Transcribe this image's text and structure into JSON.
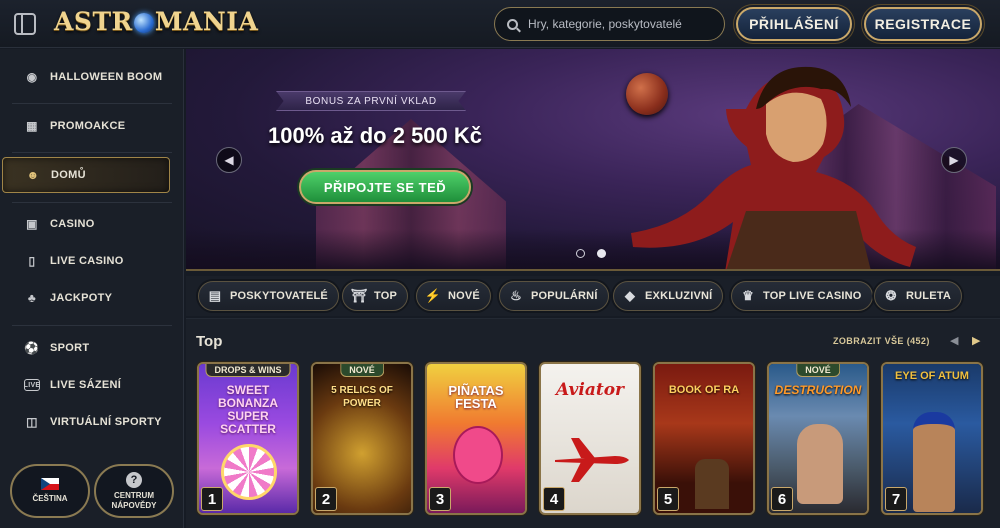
{
  "header": {
    "logo_text": "ASTROMANIA",
    "search_placeholder": "Hry, kategorie, poskytovatelé",
    "login_label": "PŘIHLÁŠENÍ",
    "register_label": "REGISTRACE"
  },
  "sidebar": {
    "items": [
      {
        "label": "HALLOWEEN BOOM",
        "icon": "pumpkin-icon"
      },
      {
        "label": "PROMOAKCE",
        "icon": "gift-icon"
      },
      {
        "label": "DOMŮ",
        "icon": "home-icon",
        "active": true
      },
      {
        "label": "CASINO",
        "icon": "slot-machine-icon"
      },
      {
        "label": "LIVE CASINO",
        "icon": "phone-icon"
      },
      {
        "label": "JACKPOTY",
        "icon": "clover-icon"
      },
      {
        "label": "SPORT",
        "icon": "soccer-ball-icon"
      },
      {
        "label": "LIVE SÁZENÍ",
        "icon": "live-icon"
      },
      {
        "label": "VIRTUÁLNÍ SPORTY",
        "icon": "monitor-icon"
      }
    ],
    "language_label": "ČEŠTINA",
    "help_label_line1": "CENTRUM",
    "help_label_line2": "NÁPOVĚDY"
  },
  "banner": {
    "ribbon_text": "BONUS ZA PRVNÍ VKLAD",
    "headline": "100% až do 2 500 Kč",
    "cta_label": "PŘIPOJTE SE TEĎ",
    "slides": 2,
    "active_slide": 2
  },
  "chips": [
    {
      "label": "POSKYTOVATELÉ",
      "icon": "providers-icon"
    },
    {
      "label": "TOP",
      "icon": "trophy-icon"
    },
    {
      "label": "NOVÉ",
      "icon": "lightning-icon"
    },
    {
      "label": "POPULÁRNÍ",
      "icon": "flame-icon"
    },
    {
      "label": "EXKLUZIVNÍ",
      "icon": "diamond-icon"
    },
    {
      "label": "TOP LIVE CASINO",
      "icon": "crown-icon"
    },
    {
      "label": "RULETA",
      "icon": "roulette-icon"
    }
  ],
  "games_section": {
    "title": "Top",
    "view_all_label": "ZOBRAZIT VŠE (452)",
    "games": [
      {
        "rank": "1",
        "badge": "DROPS & WINS",
        "title": "SWEET BONANZA SUPER SCATTER"
      },
      {
        "rank": "2",
        "badge": "NOVÉ",
        "title": "5 RELICS OF POWER"
      },
      {
        "rank": "3",
        "badge": "",
        "title": "PIÑATAS FESTA"
      },
      {
        "rank": "4",
        "badge": "",
        "title": "Aviator"
      },
      {
        "rank": "5",
        "badge": "",
        "title": "BOOK OF RA"
      },
      {
        "rank": "6",
        "badge": "NOVÉ",
        "title": "DESTRUCTION"
      },
      {
        "rank": "7",
        "badge": "",
        "title": "EYE OF ATUM"
      }
    ]
  },
  "colors": {
    "accent_gold": "#c9a86a",
    "cta_green": "#2fae4c",
    "background": "#161b24",
    "banner_purple": "#3a2458"
  }
}
